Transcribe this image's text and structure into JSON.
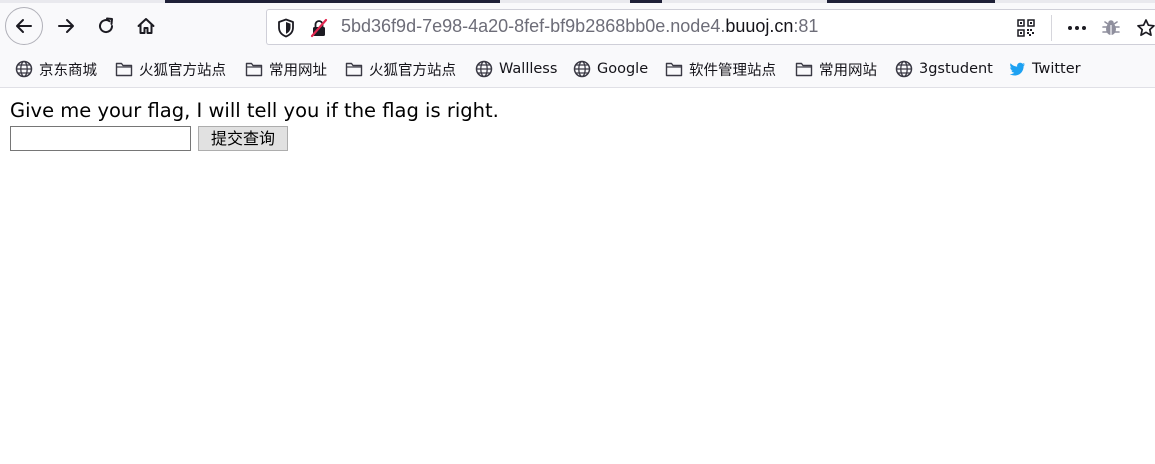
{
  "window": {
    "url_prefix": "5bd36f9d-7e98-4a20-8fef-bf9b2868bb0e.node4.",
    "url_host": "buuoj.cn",
    "url_port": ":81"
  },
  "toolbar": {
    "back_icon": "back-arrow-icon",
    "forward_icon": "forward-arrow-icon",
    "reload_icon": "reload-icon",
    "home_icon": "home-icon"
  },
  "bookmarks": [
    {
      "label": "京东商城",
      "icon": "globe-icon"
    },
    {
      "label": "火狐官方站点",
      "icon": "folder-icon"
    },
    {
      "label": "常用网址",
      "icon": "folder-icon"
    },
    {
      "label": "火狐官方站点",
      "icon": "folder-icon"
    },
    {
      "label": "Wallless",
      "icon": "globe-icon"
    },
    {
      "label": "Google",
      "icon": "globe-icon"
    },
    {
      "label": "软件管理站点",
      "icon": "folder-icon"
    },
    {
      "label": "常用网站",
      "icon": "folder-icon"
    },
    {
      "label": "3gstudent",
      "icon": "globe-icon"
    },
    {
      "label": "Twitter",
      "icon": "twitter-icon"
    }
  ],
  "page": {
    "prompt": "Give me your flag, I will tell you if the flag is right.",
    "input_value": "",
    "submit_label": "提交查询"
  },
  "colors": {
    "twitter": "#1da1f2",
    "insecure_red": "#e22850"
  }
}
